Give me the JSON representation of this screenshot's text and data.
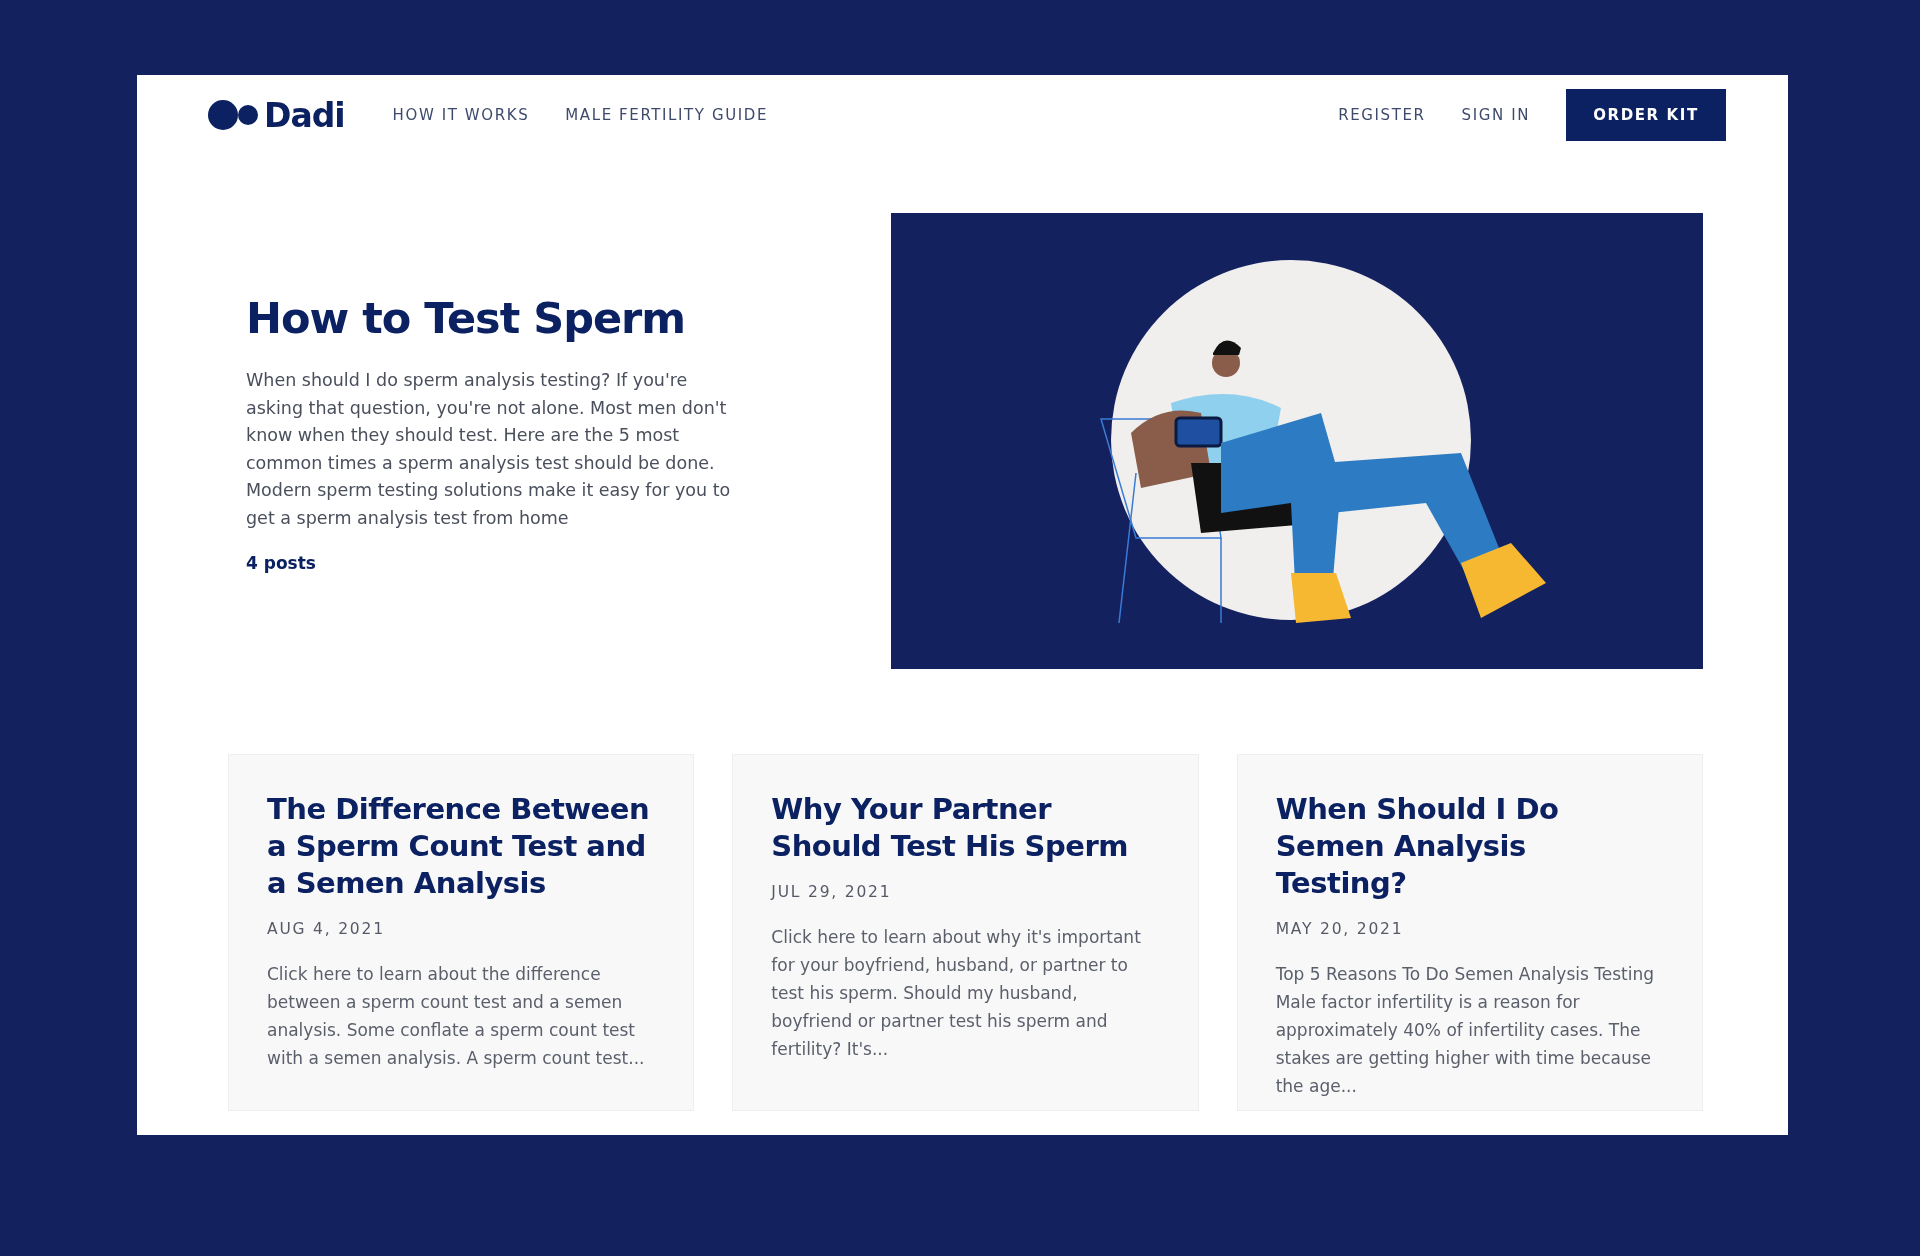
{
  "nav": {
    "logo": "Dadi",
    "links": [
      "HOW IT WORKS",
      "MALE FERTILITY GUIDE"
    ],
    "account_links": [
      "REGISTER",
      "SIGN IN"
    ],
    "cta": "ORDER KIT"
  },
  "hero": {
    "title": "How to Test Sperm",
    "description": "When should I do sperm analysis testing? If you're asking that question, you're not alone. Most men don't know when they should test. Here are the 5 most common times a sperm analysis test should be done. Modern sperm testing solutions make it easy for you to get a sperm analysis test from home",
    "posts": "4 posts"
  },
  "posts": [
    {
      "title": "The Difference Between a Sperm Count Test and a Semen Analysis",
      "date": "AUG 4, 2021",
      "excerpt": "Click here to learn about the difference between a sperm count test and a semen analysis. Some conflate a sperm count test with a semen analysis. A sperm count test..."
    },
    {
      "title": "Why Your Partner Should Test His Sperm",
      "date": "JUL 29, 2021",
      "excerpt": "Click here to learn about why it's important for your boyfriend, husband, or partner to test his sperm. Should my husband, boyfriend or partner test his sperm and fertility? It's..."
    },
    {
      "title": "When Should I Do Semen Analysis Testing?",
      "date": "MAY 20, 2021",
      "excerpt": "Top 5 Reasons To Do Semen Analysis Testing Male factor infertility is a reason for approximately 40% of infertility cases. The stakes are getting higher with time because the age..."
    }
  ]
}
